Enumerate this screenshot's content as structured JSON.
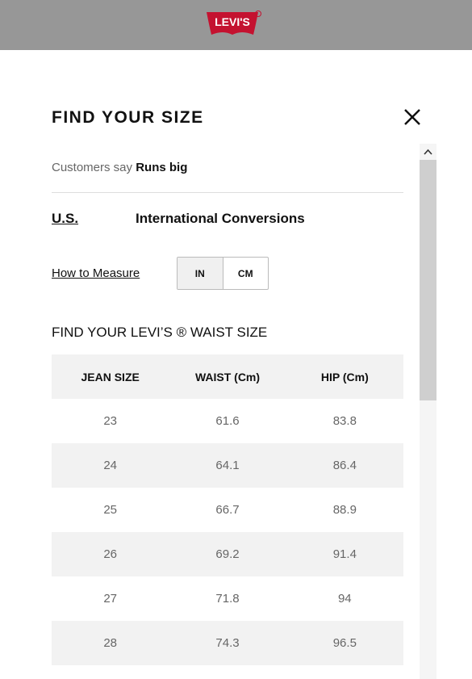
{
  "header": {
    "logo_text": "Levi's",
    "logo_color": "#c41230",
    "registered_mark": "®"
  },
  "modal": {
    "title": "FIND YOUR SIZE",
    "close_icon": "close-icon",
    "customers_prefix": "Customers say",
    "customers_value": "Runs big",
    "tabs": [
      {
        "label": "U.S.",
        "active": true
      },
      {
        "label": "International Conversions",
        "active": false
      }
    ],
    "how_to_measure": "How to Measure",
    "units": [
      {
        "label": "IN",
        "active": true
      },
      {
        "label": "CM",
        "active": false
      }
    ],
    "subheading": "FIND YOUR LEVI’S ® WAIST SIZE",
    "table": {
      "headers": [
        "JEAN SIZE",
        "WAIST (Cm)",
        "HIP (Cm)"
      ],
      "rows": [
        [
          "23",
          "61.6",
          "83.8"
        ],
        [
          "24",
          "64.1",
          "86.4"
        ],
        [
          "25",
          "66.7",
          "88.9"
        ],
        [
          "26",
          "69.2",
          "91.4"
        ],
        [
          "27",
          "71.8",
          "94"
        ],
        [
          "28",
          "74.3",
          "96.5"
        ]
      ]
    }
  },
  "scrollbar": {
    "up_icon": "chevron-up-icon"
  }
}
